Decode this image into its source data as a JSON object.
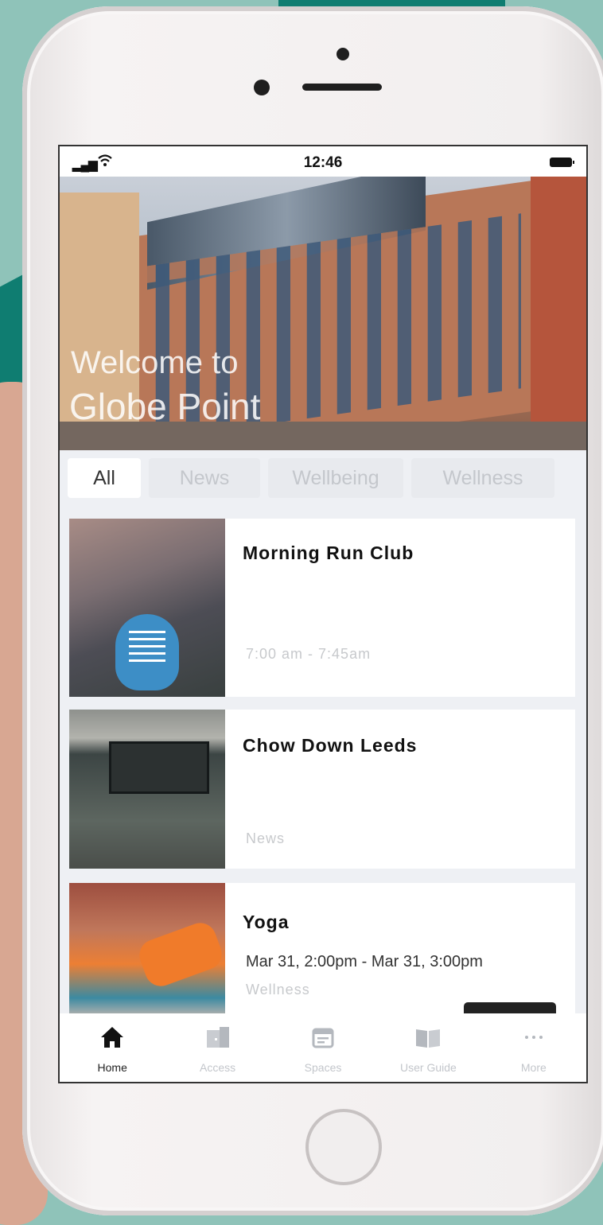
{
  "status_bar": {
    "time": "12:46"
  },
  "hero": {
    "line1": "Welcome to",
    "line2": "Globe Point"
  },
  "tabs": [
    {
      "label": "All",
      "active": true
    },
    {
      "label": "News",
      "active": false
    },
    {
      "label": "Wellbeing",
      "active": false
    },
    {
      "label": "Wellness",
      "active": false
    }
  ],
  "cards": [
    {
      "title": "Morning Run Club",
      "subtitle": "7:00 am - 7:45am"
    },
    {
      "title": "Chow Down Leeds",
      "subtitle": "News"
    },
    {
      "title": "Yoga",
      "date": "Mar 31, 2:00pm - Mar 31, 3:00pm",
      "subtitle": "Wellness"
    }
  ],
  "bottom_nav": [
    {
      "label": "Home",
      "icon": "home-icon",
      "active": true
    },
    {
      "label": "Access",
      "icon": "door-icon",
      "active": false
    },
    {
      "label": "Spaces",
      "icon": "calendar-icon",
      "active": false
    },
    {
      "label": "User Guide",
      "icon": "book-icon",
      "active": false
    },
    {
      "label": "More",
      "icon": "more-icon",
      "active": false
    }
  ],
  "colors": {
    "accent": "#0f7d71",
    "background": "#8fc3b9"
  }
}
